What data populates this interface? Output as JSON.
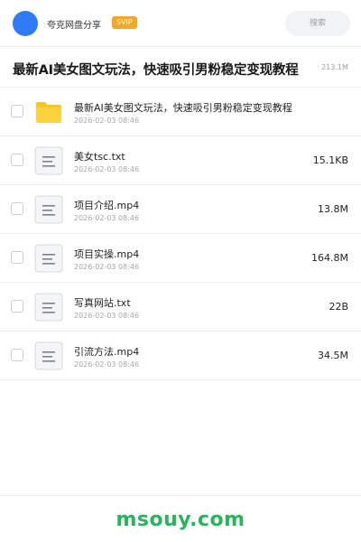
{
  "header": {
    "username": "夸克网盘分享",
    "badge": "SVIP",
    "search_placeholder": "搜索"
  },
  "share": {
    "title": "最新AI美女图文玩法，快速吸引男粉稳定变现教程",
    "total_size": "· 213.1M"
  },
  "files": [
    {
      "name": "最新AI美女图文玩法，快速吸引男粉稳定变现教程",
      "date": "2026-02-03 08:46",
      "size": "",
      "type": "folder",
      "icon": "folder-icon"
    },
    {
      "name": "美女tsc.txt",
      "date": "2026-02-03 08:46",
      "size": "15.1KB",
      "type": "file",
      "icon": "document-icon"
    },
    {
      "name": "项目介绍.mp4",
      "date": "2026-02-03 08:46",
      "size": "13.8M",
      "type": "file",
      "icon": "document-icon"
    },
    {
      "name": "项目实操.mp4",
      "date": "2026-02-03 08:46",
      "size": "164.8M",
      "type": "file",
      "icon": "document-icon"
    },
    {
      "name": "写真网站.txt",
      "date": "2026-02-03 08:46",
      "size": "22B",
      "type": "file",
      "icon": "document-icon"
    },
    {
      "name": "引流方法.mp4",
      "date": "2026-02-03 08:46",
      "size": "34.5M",
      "type": "file",
      "icon": "document-icon"
    }
  ],
  "footer": {
    "brand": "msouy.com"
  },
  "colors": {
    "avatar": "#2f7bf5",
    "svip_badge": "#f5a623",
    "folder": "#f9c525",
    "brand": "#27b45a"
  }
}
